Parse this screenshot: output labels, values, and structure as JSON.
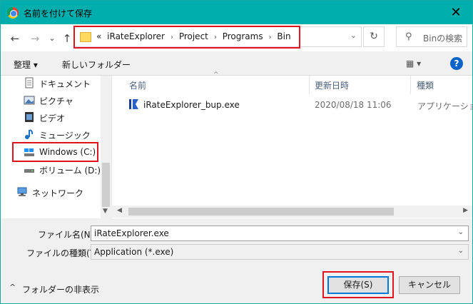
{
  "window": {
    "title": "名前を付けて保存",
    "close": "✕"
  },
  "nav": {
    "back": "←",
    "forward": "→",
    "recent": "⌄",
    "up": "↑",
    "breadcrumbs": [
      "«",
      "iRateExplorer",
      "Project",
      "Programs",
      "Bin"
    ],
    "refresh": "↻",
    "search_placeholder": "Binの検索"
  },
  "toolbar": {
    "organize": "整理 ▾",
    "new_folder": "新しいフォルダー",
    "view": "▦ ▾",
    "help": "?"
  },
  "sidebar": {
    "items": [
      {
        "label": "ドキュメント",
        "icon": "document-icon"
      },
      {
        "label": "ピクチャ",
        "icon": "picture-icon"
      },
      {
        "label": "ビデオ",
        "icon": "video-icon"
      },
      {
        "label": "ミュージック",
        "icon": "music-icon"
      },
      {
        "label": "Windows (C:)",
        "icon": "drive-icon"
      },
      {
        "label": "ボリューム (D:)",
        "icon": "drive-icon"
      },
      {
        "label": "ネットワーク",
        "icon": "network-icon"
      }
    ]
  },
  "filelist": {
    "columns": [
      "名前",
      "更新日時",
      "種類"
    ],
    "rows": [
      {
        "name": "iRateExplorer_bup.exe",
        "date": "2020/08/18 11:06",
        "type": "アプリケーション"
      }
    ]
  },
  "form": {
    "filename_label": "ファイル名(N):",
    "filename_value": "iRateExplorer.exe",
    "filetype_label": "ファイルの種類(T):",
    "filetype_value": "Application (*.exe)"
  },
  "footer": {
    "hide_folders": "フォルダーの非表示",
    "save": "保存(S)",
    "cancel": "キャンセル"
  },
  "colors": {
    "titlebar": "#00aead",
    "highlight": "#e0141e",
    "accent": "#0078d7"
  }
}
